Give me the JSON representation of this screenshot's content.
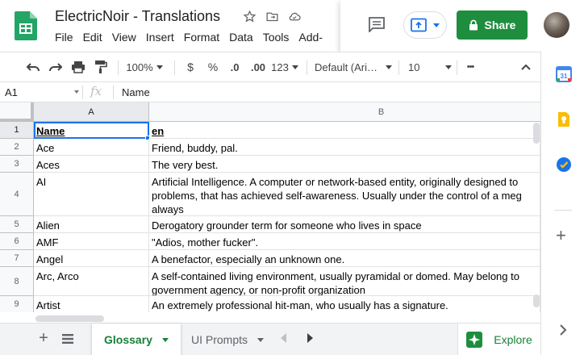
{
  "header": {
    "title": "ElectricNoir - Translations",
    "menu": [
      "File",
      "Edit",
      "View",
      "Insert",
      "Format",
      "Data",
      "Tools",
      "Add-"
    ],
    "share_label": "Share"
  },
  "toolbar": {
    "zoom": "100%",
    "currency": "$",
    "percent": "%",
    "dec_less": ".0",
    "dec_more": ".00",
    "format_more": "123",
    "font": "Default (Ari…",
    "font_size": "10",
    "more": "•••"
  },
  "formula_bar": {
    "cell_ref": "A1",
    "fx": "fx",
    "value": "Name"
  },
  "columns": [
    "A",
    "B"
  ],
  "rows": [
    {
      "num": "1",
      "a": "Name",
      "b": "en"
    },
    {
      "num": "2",
      "a": "Ace",
      "b": "Friend, buddy, pal."
    },
    {
      "num": "3",
      "a": "Aces",
      "b": "The very best."
    },
    {
      "num": "4",
      "a": "AI",
      "b": "Artificial Intelligence. A computer or network-based entity, originally designed to problems, that has achieved self-awareness. Usually under the control of a meg always"
    },
    {
      "num": "5",
      "a": "Alien",
      "b": "Derogatory grounder term for someone who lives in space"
    },
    {
      "num": "6",
      "a": "AMF",
      "b": "\"Adios, mother fucker\"."
    },
    {
      "num": "7",
      "a": "Angel",
      "b": "A benefactor, especially an unknown one."
    },
    {
      "num": "8",
      "a": "Arc, Arco",
      "b": "A self-contained living environment, usually pyramidal or domed. May belong to government agency, or non-profit organization"
    },
    {
      "num": "9",
      "a": "Artist",
      "b": "An extremely professional hit-man, who usually has a signature."
    }
  ],
  "row4_lines": [
    "Artificial Intelligence. A computer or network-based entity, originally designed to",
    "problems, that has achieved self-awareness. Usually under the control of a meg",
    "always"
  ],
  "row8_lines": [
    "A self-contained living environment, usually pyramidal or domed. May belong to",
    "government agency, or non-profit organization"
  ],
  "tabs": {
    "active": "Glossary",
    "other": "UI Prompts",
    "explore": "Explore"
  },
  "colors": {
    "share_green": "#1e8e3e",
    "active_tab_green": "#188038",
    "selection_blue": "#1a73e8"
  }
}
